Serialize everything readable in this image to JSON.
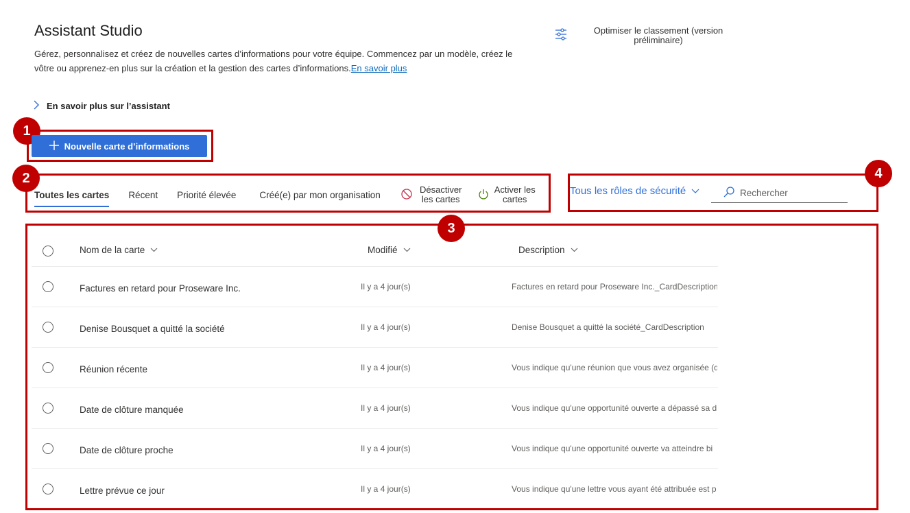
{
  "header": {
    "title": "Assistant Studio",
    "subtitle": "Gérez, personnalisez et créez de nouvelles cartes d’informations pour votre équipe. Commencez par un modèle, créez le vôtre ou apprenez-en plus sur la création et la gestion des cartes d’informations.",
    "learn_more_link": "En savoir plus",
    "optimize_label": "Optimiser le classement (version préliminaire)"
  },
  "learn_assistant": "En savoir plus sur l’assistant",
  "new_card_button": "Nouvelle carte d’informations",
  "tabs": [
    {
      "label": "Toutes les cartes",
      "active": true
    },
    {
      "label": "Récent",
      "active": false
    },
    {
      "label": "Priorité élevée",
      "active": false
    },
    {
      "label": "Créé(e) par mon organisation",
      "active": false
    }
  ],
  "actions": {
    "deactivate": "Désactiver les cartes",
    "activate": "Activer les cartes"
  },
  "filter": {
    "roles": "Tous les rôles de sécurité",
    "search_placeholder": "Rechercher"
  },
  "table": {
    "columns": {
      "name": "Nom de la carte",
      "modified": "Modifié",
      "description": "Description"
    },
    "rows": [
      {
        "name": "Factures en retard pour Proseware Inc.",
        "modified": "Il y a 4 jour(s)",
        "description": "Factures en retard pour Proseware Inc._CardDescription"
      },
      {
        "name": "Denise Bousquet a quitté la société",
        "modified": "Il y a 4 jour(s)",
        "description": "Denise Bousquet a quitté la société_CardDescription"
      },
      {
        "name": "Réunion récente",
        "modified": "Il y a 4 jour(s)",
        "description": "Vous indique qu'une réunion que vous avez organisée (d"
      },
      {
        "name": "Date de clôture manquée",
        "modified": "Il y a 4 jour(s)",
        "description": "Vous indique qu'une opportunité ouverte a dépassé sa d"
      },
      {
        "name": "Date de clôture proche",
        "modified": "Il y a 4 jour(s)",
        "description": "Vous indique qu'une opportunité ouverte va atteindre bi"
      },
      {
        "name": "Lettre prévue ce jour",
        "modified": "Il y a 4 jour(s)",
        "description": "Vous indique qu'une lettre vous ayant été attribuée est p"
      }
    ]
  },
  "callouts": [
    "1",
    "2",
    "3",
    "4"
  ],
  "colors": {
    "accent": "#2f6fd7",
    "callout": "#c00000"
  }
}
